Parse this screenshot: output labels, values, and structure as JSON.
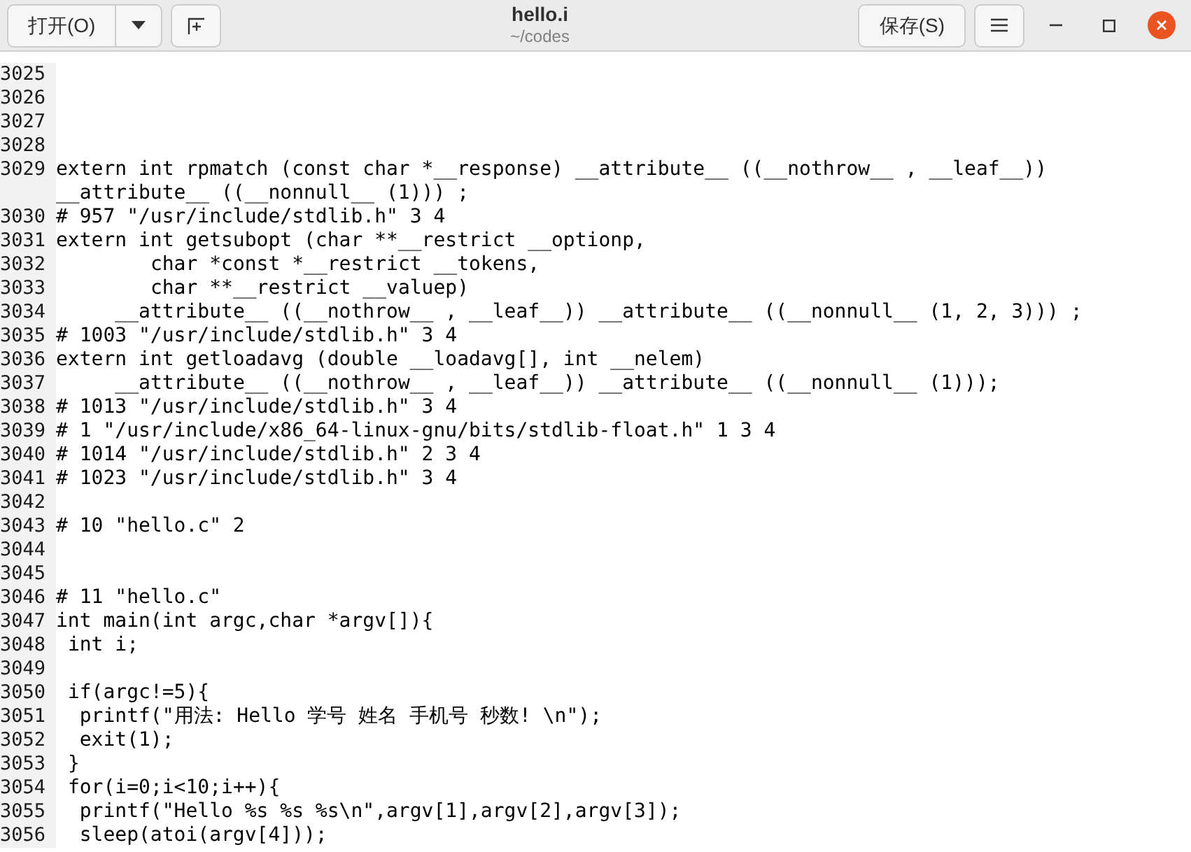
{
  "header": {
    "open_button": "打开(O)",
    "title": "hello.i",
    "subtitle": "~/codes",
    "save_button": "保存(S)"
  },
  "lines": [
    {
      "number": "3025"
    },
    {
      "number": "3026"
    },
    {
      "number": "3027"
    },
    {
      "number": "3028"
    },
    {
      "number": "3029",
      "text": "extern int rpmatch (const char *__response) __attribute__ ((__nothrow__ , __leaf__)) __attribute__ ((__nonnull__ (1))) ;"
    },
    {
      "number": "3030",
      "text": "# 957 \"/usr/include/stdlib.h\" 3 4"
    },
    {
      "number": "3031",
      "text": "extern int getsubopt (char **__restrict __optionp,"
    },
    {
      "number": "3032",
      "text": "        char *const *__restrict __tokens,"
    },
    {
      "number": "3033",
      "text": "        char **__restrict __valuep)"
    },
    {
      "number": "3034",
      "text": "     __attribute__ ((__nothrow__ , __leaf__)) __attribute__ ((__nonnull__ (1, 2, 3))) ;"
    },
    {
      "number": "3035",
      "text": "# 1003 \"/usr/include/stdlib.h\" 3 4"
    },
    {
      "number": "3036",
      "text": "extern int getloadavg (double __loadavg[], int __nelem)"
    },
    {
      "number": "3037",
      "text": "     __attribute__ ((__nothrow__ , __leaf__)) __attribute__ ((__nonnull__ (1)));"
    },
    {
      "number": "3038",
      "text": "# 1013 \"/usr/include/stdlib.h\" 3 4"
    },
    {
      "number": "3039",
      "text": "# 1 \"/usr/include/x86_64-linux-gnu/bits/stdlib-float.h\" 1 3 4"
    },
    {
      "number": "3040",
      "text": "# 1014 \"/usr/include/stdlib.h\" 2 3 4"
    },
    {
      "number": "3041",
      "text": "# 1023 \"/usr/include/stdlib.h\" 3 4"
    },
    {
      "number": "3042"
    },
    {
      "number": "3043",
      "text": "# 10 \"hello.c\" 2"
    },
    {
      "number": "3044"
    },
    {
      "number": "3045"
    },
    {
      "number": "3046",
      "text": "# 11 \"hello.c\""
    },
    {
      "number": "3047",
      "text": "int main(int argc,char *argv[]){"
    },
    {
      "number": "3048",
      "text": " int i;"
    },
    {
      "number": "3049"
    },
    {
      "number": "3050",
      "text": " if(argc!=5){"
    },
    {
      "number": "3051",
      "text": "  printf(\"用法: Hello 学号 姓名 手机号 秒数! \\n\");"
    },
    {
      "number": "3052",
      "text": "  exit(1);"
    },
    {
      "number": "3053",
      "text": " }"
    },
    {
      "number": "3054",
      "text": " for(i=0;i<10;i++){"
    },
    {
      "number": "3055",
      "text": "  printf(\"Hello %s %s %s\\n\",argv[1],argv[2],argv[3]);"
    },
    {
      "number": "3056",
      "text": "  sleep(atoi(argv[4]));"
    }
  ]
}
